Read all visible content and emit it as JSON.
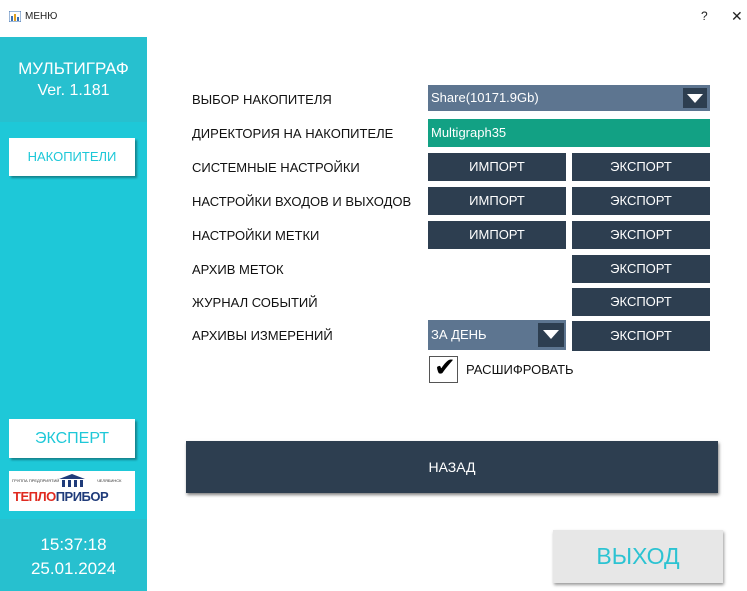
{
  "window": {
    "title": "МЕНЮ",
    "help_label": "?",
    "close_label": "✕"
  },
  "sidebar": {
    "app_name": "МУЛЬТИГРАФ",
    "version": "Ver. 1.181",
    "storage_button": "НАКОПИТЕЛИ",
    "expert_button": "ЭКСПЕРТ",
    "logo": {
      "small_left": "ГРУППА ПРЕДПРИЯТИЙ",
      "small_right": "ЧЕЛЯБИНСК",
      "part1": "ТЕПЛО",
      "part2": "ПРИБОР"
    },
    "time": "15:37:18",
    "date": "25.01.2024"
  },
  "rows": {
    "storage_select": {
      "label": "ВЫБОР НАКОПИТЕЛЯ",
      "value": "Share(10171.9Gb)"
    },
    "directory": {
      "label": "ДИРЕКТОРИЯ НА НАКОПИТЕЛЕ",
      "value": "Multigraph35"
    },
    "system": {
      "label": "СИСТЕМНЫЕ НАСТРОЙКИ"
    },
    "io": {
      "label": "НАСТРОЙКИ ВХОДОВ И ВЫХОДОВ"
    },
    "mark": {
      "label": "НАСТРОЙКИ МЕТКИ"
    },
    "mark_archive": {
      "label": "АРХИВ МЕТОК"
    },
    "event_log": {
      "label": "ЖУРНАЛ СОБЫТИЙ"
    },
    "measure_archive": {
      "label": "АРХИВЫ ИЗМЕРЕНИЙ",
      "period": "ЗА ДЕНЬ"
    }
  },
  "buttons": {
    "import": "ИМПОРТ",
    "export": "ЭКСПОРТ"
  },
  "decode": {
    "label": "РАСШИФРОВАТЬ",
    "checked_mark": "✔"
  },
  "back_button": "НАЗАД",
  "exit_button": "ВЫХОД",
  "colors": {
    "accent": "#1ec8d8",
    "dark": "#2d3e50",
    "select": "#5d7590",
    "green": "#12a184"
  }
}
